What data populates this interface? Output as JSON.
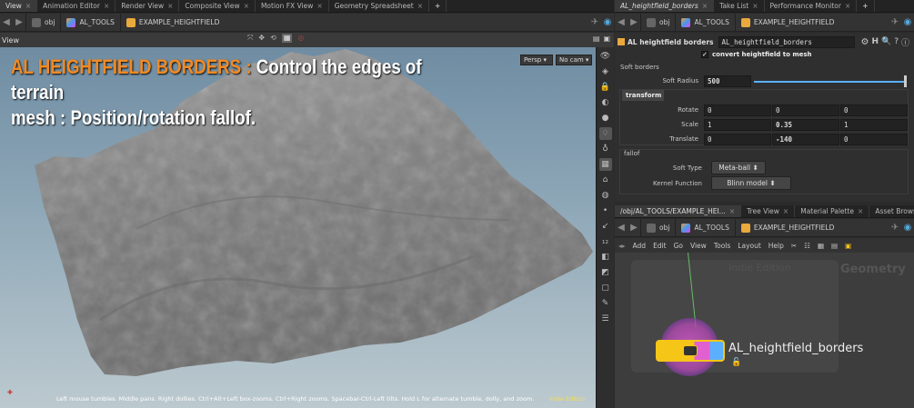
{
  "left_tabs": [
    "View",
    "Animation Editor",
    "Render View",
    "Composite View",
    "Motion FX View",
    "Geometry Spreadsheet",
    "+"
  ],
  "right_tabs": [
    "AL_heightfield_borders",
    "Take List",
    "Performance Monitor",
    "+"
  ],
  "path": {
    "obj": "obj",
    "tools": "AL_TOOLS",
    "node": "EXAMPLE_HEIGHTFIELD"
  },
  "viewport": {
    "label": "View",
    "persp": "Persp",
    "cam": "No cam",
    "title_orange": "AL HEIGHTFIELD BORDERS :",
    "title_white": "Control the edges of terrain",
    "title_line2": "mesh : Position/rotation fallof.",
    "status": "Left mouse tumbles. Middle pans. Right dollies. Ctrl+Alt+Left box-zooms. Ctrl+Right zooms. Spacebar-Ctrl-Left tilts. Hold L for alternate tumble, dolly, and zoom.",
    "edition": "Indie Edition"
  },
  "params": {
    "node_type": "AL heightfield borders",
    "node_name": "AL_heightfield_borders",
    "convert": "convert heightfield to mesh",
    "soft_borders": "Soft borders",
    "soft_radius_label": "Soft Radius",
    "soft_radius": "500",
    "transform_tab": "transform",
    "rotate_label": "Rotate",
    "rotate": [
      "0",
      "0",
      "0"
    ],
    "scale_label": "Scale",
    "scale": [
      "1",
      "0.35",
      "1"
    ],
    "translate_label": "Translate",
    "translate": [
      "0",
      "-140",
      "0"
    ],
    "fallof": "fallof",
    "soft_type_label": "Soft Type",
    "soft_type": "Meta-ball",
    "kernel_label": "Kernel Function",
    "kernel": "Blinn model"
  },
  "net_tabs": [
    "/obj/AL_TOOLS/EXAMPLE_HEI...",
    "Tree View",
    "Material Palette",
    "Asset Browser",
    "+"
  ],
  "net_menu": [
    "Add",
    "Edit",
    "Go",
    "View",
    "Tools",
    "Layout",
    "Help"
  ],
  "network": {
    "edition": "Indie Edition",
    "context": "Geometry",
    "node_label": "AL_heightfield_borders"
  },
  "colors": {
    "accent": "#f08a24",
    "node_yellow": "#f5c518",
    "highlight": "#e85ce0"
  }
}
